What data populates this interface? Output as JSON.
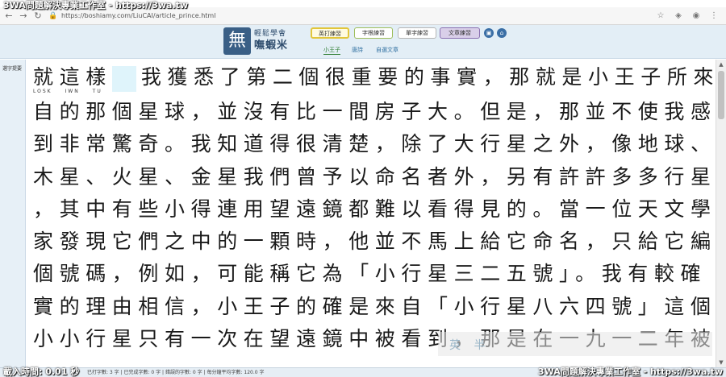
{
  "watermark": {
    "top": "3WA問題解決專業工作室 - https://3wa.tw",
    "bottom_right": "3WA問題解決專業工作室 - https://3wa.tw",
    "bottom_left": "載入時間: 0.01 秒"
  },
  "browser": {
    "url": "https://boshiamy.com/LiuCAI/article_prince.html",
    "back_icon": "arrow-left-icon",
    "forward_icon": "arrow-right-icon",
    "reload_icon": "reload-icon",
    "lock_icon": "lock-icon"
  },
  "site": {
    "logo_glyph": "無",
    "logo_line1": "輕鬆學會",
    "logo_line2": "嘸蝦米",
    "tabs": [
      {
        "label": "英打練習"
      },
      {
        "label": "字根練習"
      },
      {
        "label": "單字練習"
      },
      {
        "label": "文章練習"
      }
    ],
    "sub_tabs": [
      {
        "label": "小王子"
      },
      {
        "label": "唐詩"
      },
      {
        "label": "自選文章"
      }
    ],
    "accent": "#3a5f86"
  },
  "side": {
    "label": "選字提要"
  },
  "reading": {
    "line1_before": "就這樣",
    "line1_after": "我獲悉了第二個很重要的事實，那就是小王子所來",
    "romanization": [
      "LOSK",
      "IWN",
      "TU"
    ],
    "lines": [
      "自的那個星球，並沒有比一間房子大。但是，那並不使我感",
      "到非常驚奇。我知道得很清楚，除了大行星之外，像地球、",
      "木星、火星、金星我們曾予以命名者外，另有許許多多行星",
      "，其中有些小得連用望遠鏡都難以看得見的。當一位天文學",
      "家發現它們之中的一顆時，他並不馬上給它命名，只給它編",
      "個號碼，例如，可能稱它為「小行星三二五號」。我有較確",
      "實的理由相信，小王子的確是來自「小行星八六四號」這個",
      "小小行星只有一次在望遠鏡中被看到，那是在一九一二年被"
    ],
    "typing_label": "英 半"
  },
  "status": {
    "text": "已打字數: 3 字 | 已完成字數: 0 字 | 錯誤的字數: 0 字 | 每分鐘平均字數: 120.0 字"
  }
}
